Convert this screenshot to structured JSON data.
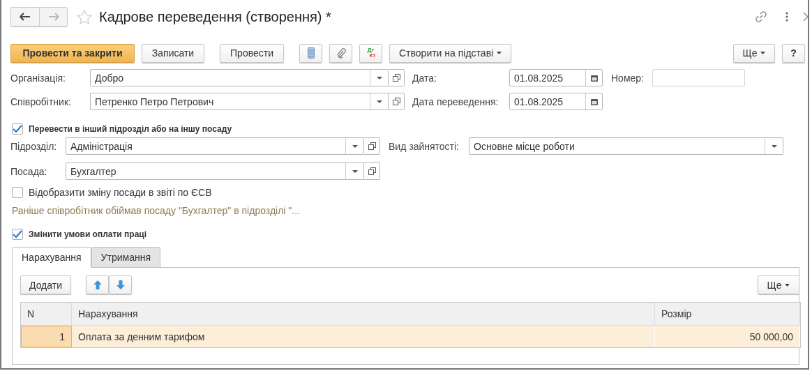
{
  "window": {
    "title": "Кадрове переведення (створення) *"
  },
  "toolbar": [
    {
      "kind": "primary",
      "label": "Провести та закрити"
    },
    {
      "kind": "text",
      "label": "Записати"
    },
    {
      "kind": "text",
      "label": "Провести"
    },
    {
      "kind": "list"
    },
    {
      "kind": "clip"
    },
    {
      "kind": "dtkt",
      "marks": [
        "Дт",
        "Кт"
      ]
    },
    {
      "kind": "menu",
      "label": "Створити на підставі"
    }
  ],
  "toolbar_right": [
    {
      "kind": "menu",
      "label": "Ще"
    },
    {
      "kind": "help",
      "label": "?"
    }
  ],
  "organization": {
    "label": "Організація:",
    "value": "Добро"
  },
  "date": {
    "label": "Дата:",
    "value": "01.08.2025"
  },
  "number": {
    "label": "Номер:"
  },
  "employee": {
    "label": "Співробітник:",
    "value": "Петренко Петро Петрович"
  },
  "transfer_date": {
    "label": "Дата переведення:",
    "value": "01.08.2025"
  },
  "transfer": {
    "label": "Перевести в інший підрозділ або на іншу посаду",
    "checked": true
  },
  "department": {
    "label": "Підрозділ:",
    "value": "Адміністрація"
  },
  "employment": {
    "label": "Вид зайнятості:",
    "value": "Основне місце роботи"
  },
  "position": {
    "label": "Посада:",
    "value": "Бухгалтер"
  },
  "show_esv": {
    "label": "Відобразити зміну посади в звіті по ЄСВ",
    "checked": false
  },
  "note": "Раніше співробітник обіймав посаду \"Бухгалтер\" в підрозділі \"...",
  "change_pay": {
    "label": "Змінити умови оплати праці",
    "checked": true
  },
  "tabs": [
    {
      "label": "Нарахування",
      "selected": true
    },
    {
      "label": "Утримання",
      "selected": false
    }
  ],
  "table_toolbar": {
    "add": "Додати",
    "more": "Ще"
  },
  "table": {
    "columns": [
      "N",
      "Нарахування",
      "Розмір"
    ],
    "rows": [
      {
        "cells": [
          "1",
          "Оплата за денним тарифом",
          "50 000,00"
        ],
        "selected": true
      }
    ]
  }
}
